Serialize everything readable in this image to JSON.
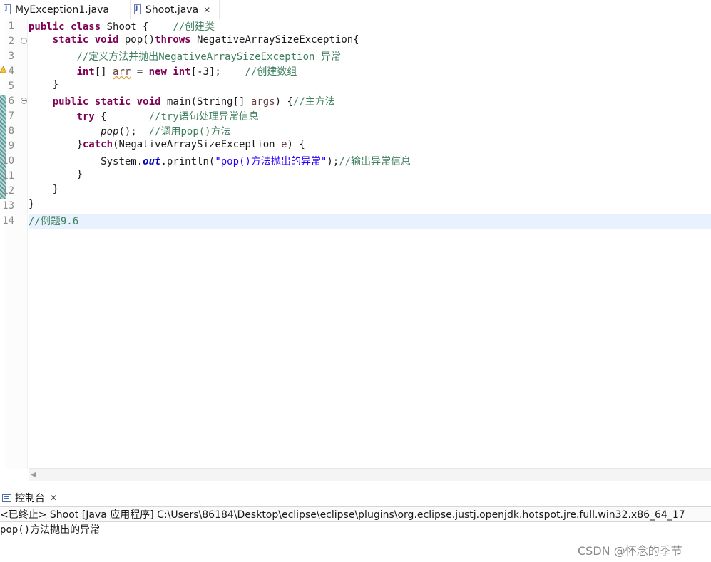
{
  "tabs": [
    {
      "label": "MyException1.java",
      "active": false
    },
    {
      "label": "Shoot.java",
      "active": true
    }
  ],
  "icons": {
    "file": "java-file-icon",
    "close": "close-icon",
    "warning": "warning-icon",
    "fold": "fold-minus-icon",
    "console": "console-monitor-icon",
    "scroll": "scroll-left-arrow-icon"
  },
  "colors": {
    "keyword": "#7f0055",
    "comment": "#3f7f5f",
    "string": "#2a00ff",
    "field": "#0000c0",
    "current_line": "#e8f2fe"
  },
  "editor": {
    "line_numbers": [
      "1",
      "2",
      "3",
      "4",
      "5",
      "6",
      "7",
      "8",
      "9",
      "10",
      "11",
      "12",
      "13",
      "14"
    ],
    "lines": {
      "l1": {
        "kw1": "public",
        "kw2": "class",
        "name": " Shoot {    ",
        "comment": "//创建类"
      },
      "l2": {
        "kw1": "static",
        "kw2": "void",
        "name": " pop()",
        "kw3": "throws",
        "rest": " NegativeArraySizeException{"
      },
      "l3": {
        "comment": "//定义方法并抛出NegativeArraySizeException 异常"
      },
      "l4": {
        "kw1": "int",
        "t1": "[] ",
        "var": "arr",
        "t2": " = ",
        "kw2": "new",
        "kw3": "int",
        "t3": "[-3];    ",
        "comment": "//创建数组"
      },
      "l5": {
        "text": "}"
      },
      "l6": {
        "kw1": "public",
        "kw2": "static",
        "kw3": "void",
        "t1": " main(String[] ",
        "var": "args",
        "t2": ") {",
        "comment": "//主方法"
      },
      "l7": {
        "kw1": "try",
        "t1": " {       ",
        "comment": "//try语句处理异常信息"
      },
      "l8": {
        "call": "pop",
        "t1": "();  ",
        "comment": "//调用pop()方法"
      },
      "l9": {
        "t0": "}",
        "kw1": "catch",
        "t1": "(NegativeArraySizeException ",
        "var": "e",
        "t2": ") {"
      },
      "l10": {
        "t0": "System.",
        "field": "out",
        "t1": ".println(",
        "str": "\"pop()方法抛出的异常\"",
        "t2": ");",
        "comment": "//输出异常信息"
      },
      "l11": {
        "text": "}"
      },
      "l12": {
        "text": "}"
      },
      "l13": {
        "text": "}"
      },
      "l14": {
        "comment": "//例题9.6"
      }
    }
  },
  "console": {
    "tab_label": "控制台",
    "description": "<已终止> Shoot [Java 应用程序] C:\\Users\\86184\\Desktop\\eclipse\\eclipse\\plugins\\org.eclipse.justj.openjdk.hotspot.jre.full.win32.x86_64_17",
    "output": "pop()方法抛出的异常"
  },
  "watermark": "CSDN @怀念的季节"
}
